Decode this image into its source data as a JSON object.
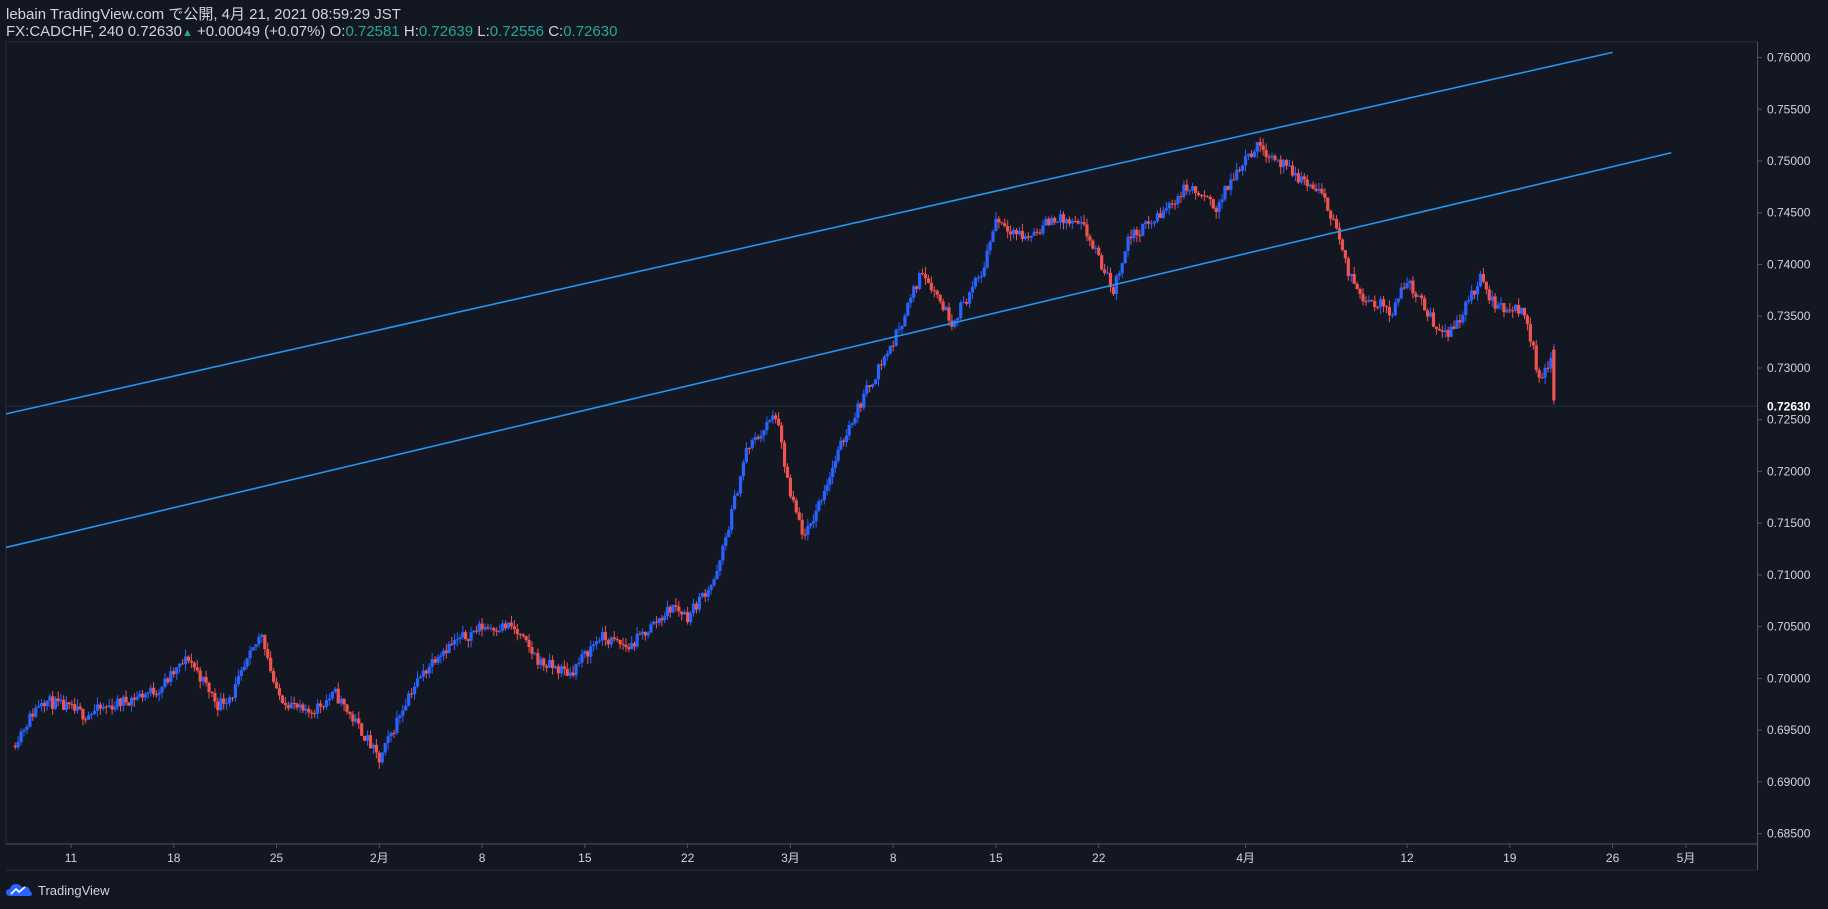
{
  "header": {
    "line1": "lebain TradingView.com で公開, 4月 21, 2021 08:59:29 JST",
    "symbol": "FX:CADCHF, 240",
    "last": "0.72630",
    "change": "+0.00049 (+0.07%)",
    "o_label": "O:",
    "o_val": "0.72581",
    "h_label": "H:",
    "h_val": "0.72639",
    "l_label": "L:",
    "l_val": "0.72556",
    "c_label": "C:",
    "c_val": "0.72630"
  },
  "brand": "TradingView",
  "colors": {
    "bg": "#131722",
    "up": "#2962ff",
    "down": "#ef5350",
    "channel": "#2196f3",
    "text": "#d1d4dc",
    "accent": "#26a69a"
  },
  "chart_data": {
    "type": "candlestick",
    "ylim": [
      0.684,
      0.7615
    ],
    "y_ticks": [
      "0.76000",
      "0.75500",
      "0.75000",
      "0.74500",
      "0.74000",
      "0.73500",
      "0.73000",
      "0.72500",
      "0.72000",
      "0.71500",
      "0.71000",
      "0.70500",
      "0.70000",
      "0.69500",
      "0.69000",
      "0.68500"
    ],
    "last_price": "0.72630",
    "x_ticks": [
      {
        "label": "11",
        "date": "2021-01-11"
      },
      {
        "label": "18",
        "date": "2021-01-18"
      },
      {
        "label": "25",
        "date": "2021-01-25"
      },
      {
        "label": "2月",
        "date": "2021-02-01"
      },
      {
        "label": "8",
        "date": "2021-02-08"
      },
      {
        "label": "15",
        "date": "2021-02-15"
      },
      {
        "label": "22",
        "date": "2021-02-22"
      },
      {
        "label": "3月",
        "date": "2021-03-01"
      },
      {
        "label": "8",
        "date": "2021-03-08"
      },
      {
        "label": "15",
        "date": "2021-03-15"
      },
      {
        "label": "22",
        "date": "2021-03-22"
      },
      {
        "label": "4月",
        "date": "2021-04-01"
      },
      {
        "label": "12",
        "date": "2021-04-12"
      },
      {
        "label": "19",
        "date": "2021-04-19"
      },
      {
        "label": "26",
        "date": "2021-04-26"
      },
      {
        "label": "5月",
        "date": "2021-05-01"
      }
    ],
    "price_path": [
      [
        "2021-01-07",
        0.6935
      ],
      [
        "2021-01-09",
        0.698
      ],
      [
        "2021-01-12",
        0.6965
      ],
      [
        "2021-01-14",
        0.6975
      ],
      [
        "2021-01-17",
        0.699
      ],
      [
        "2021-01-19",
        0.702
      ],
      [
        "2021-01-21",
        0.6975
      ],
      [
        "2021-01-22",
        0.6985
      ],
      [
        "2021-01-24",
        0.7045
      ],
      [
        "2021-01-25",
        0.6985
      ],
      [
        "2021-01-27",
        0.6965
      ],
      [
        "2021-01-29",
        0.6985
      ],
      [
        "2021-01-31",
        0.6945
      ],
      [
        "2021-02-01",
        0.692
      ],
      [
        "2021-02-03",
        0.6985
      ],
      [
        "2021-02-05",
        0.7025
      ],
      [
        "2021-02-08",
        0.705
      ],
      [
        "2021-02-10",
        0.705
      ],
      [
        "2021-02-12",
        0.7015
      ],
      [
        "2021-02-14",
        0.7005
      ],
      [
        "2021-02-16",
        0.704
      ],
      [
        "2021-02-18",
        0.703
      ],
      [
        "2021-02-21",
        0.707
      ],
      [
        "2021-02-22",
        0.706
      ],
      [
        "2021-02-24",
        0.71
      ],
      [
        "2021-02-26",
        0.722
      ],
      [
        "2021-02-28",
        0.7255
      ],
      [
        "2021-03-01",
        0.7175
      ],
      [
        "2021-03-02",
        0.7135
      ],
      [
        "2021-03-05",
        0.7245
      ],
      [
        "2021-03-07",
        0.73
      ],
      [
        "2021-03-08",
        0.7325
      ],
      [
        "2021-03-10",
        0.7395
      ],
      [
        "2021-03-12",
        0.7345
      ],
      [
        "2021-03-14",
        0.739
      ],
      [
        "2021-03-15",
        0.7445
      ],
      [
        "2021-03-17",
        0.7425
      ],
      [
        "2021-03-19",
        0.7445
      ],
      [
        "2021-03-21",
        0.7435
      ],
      [
        "2021-03-23",
        0.7375
      ],
      [
        "2021-03-24",
        0.7425
      ],
      [
        "2021-03-26",
        0.7445
      ],
      [
        "2021-03-28",
        0.7475
      ],
      [
        "2021-03-30",
        0.7455
      ],
      [
        "2021-04-01",
        0.7505
      ],
      [
        "2021-04-02",
        0.7515
      ],
      [
        "2021-04-04",
        0.749
      ],
      [
        "2021-04-06",
        0.747
      ],
      [
        "2021-04-07",
        0.7445
      ],
      [
        "2021-04-08",
        0.739
      ],
      [
        "2021-04-09",
        0.737
      ],
      [
        "2021-04-11",
        0.7355
      ],
      [
        "2021-04-12",
        0.7385
      ],
      [
        "2021-04-14",
        0.734
      ],
      [
        "2021-04-15",
        0.7335
      ],
      [
        "2021-04-17",
        0.7385
      ],
      [
        "2021-04-18",
        0.736
      ],
      [
        "2021-04-20",
        0.7355
      ],
      [
        "2021-04-21",
        0.729
      ],
      [
        "2021-04-22",
        0.7315
      ],
      [
        "2021-04-22",
        0.7263
      ]
    ],
    "trendlines": [
      {
        "from": [
          "2021-01-07",
          0.7257
        ],
        "to": [
          "2021-04-26",
          0.7605
        ]
      },
      {
        "from": [
          "2021-01-07",
          0.7128
        ],
        "to": [
          "2021-04-30",
          0.7508
        ]
      }
    ]
  }
}
